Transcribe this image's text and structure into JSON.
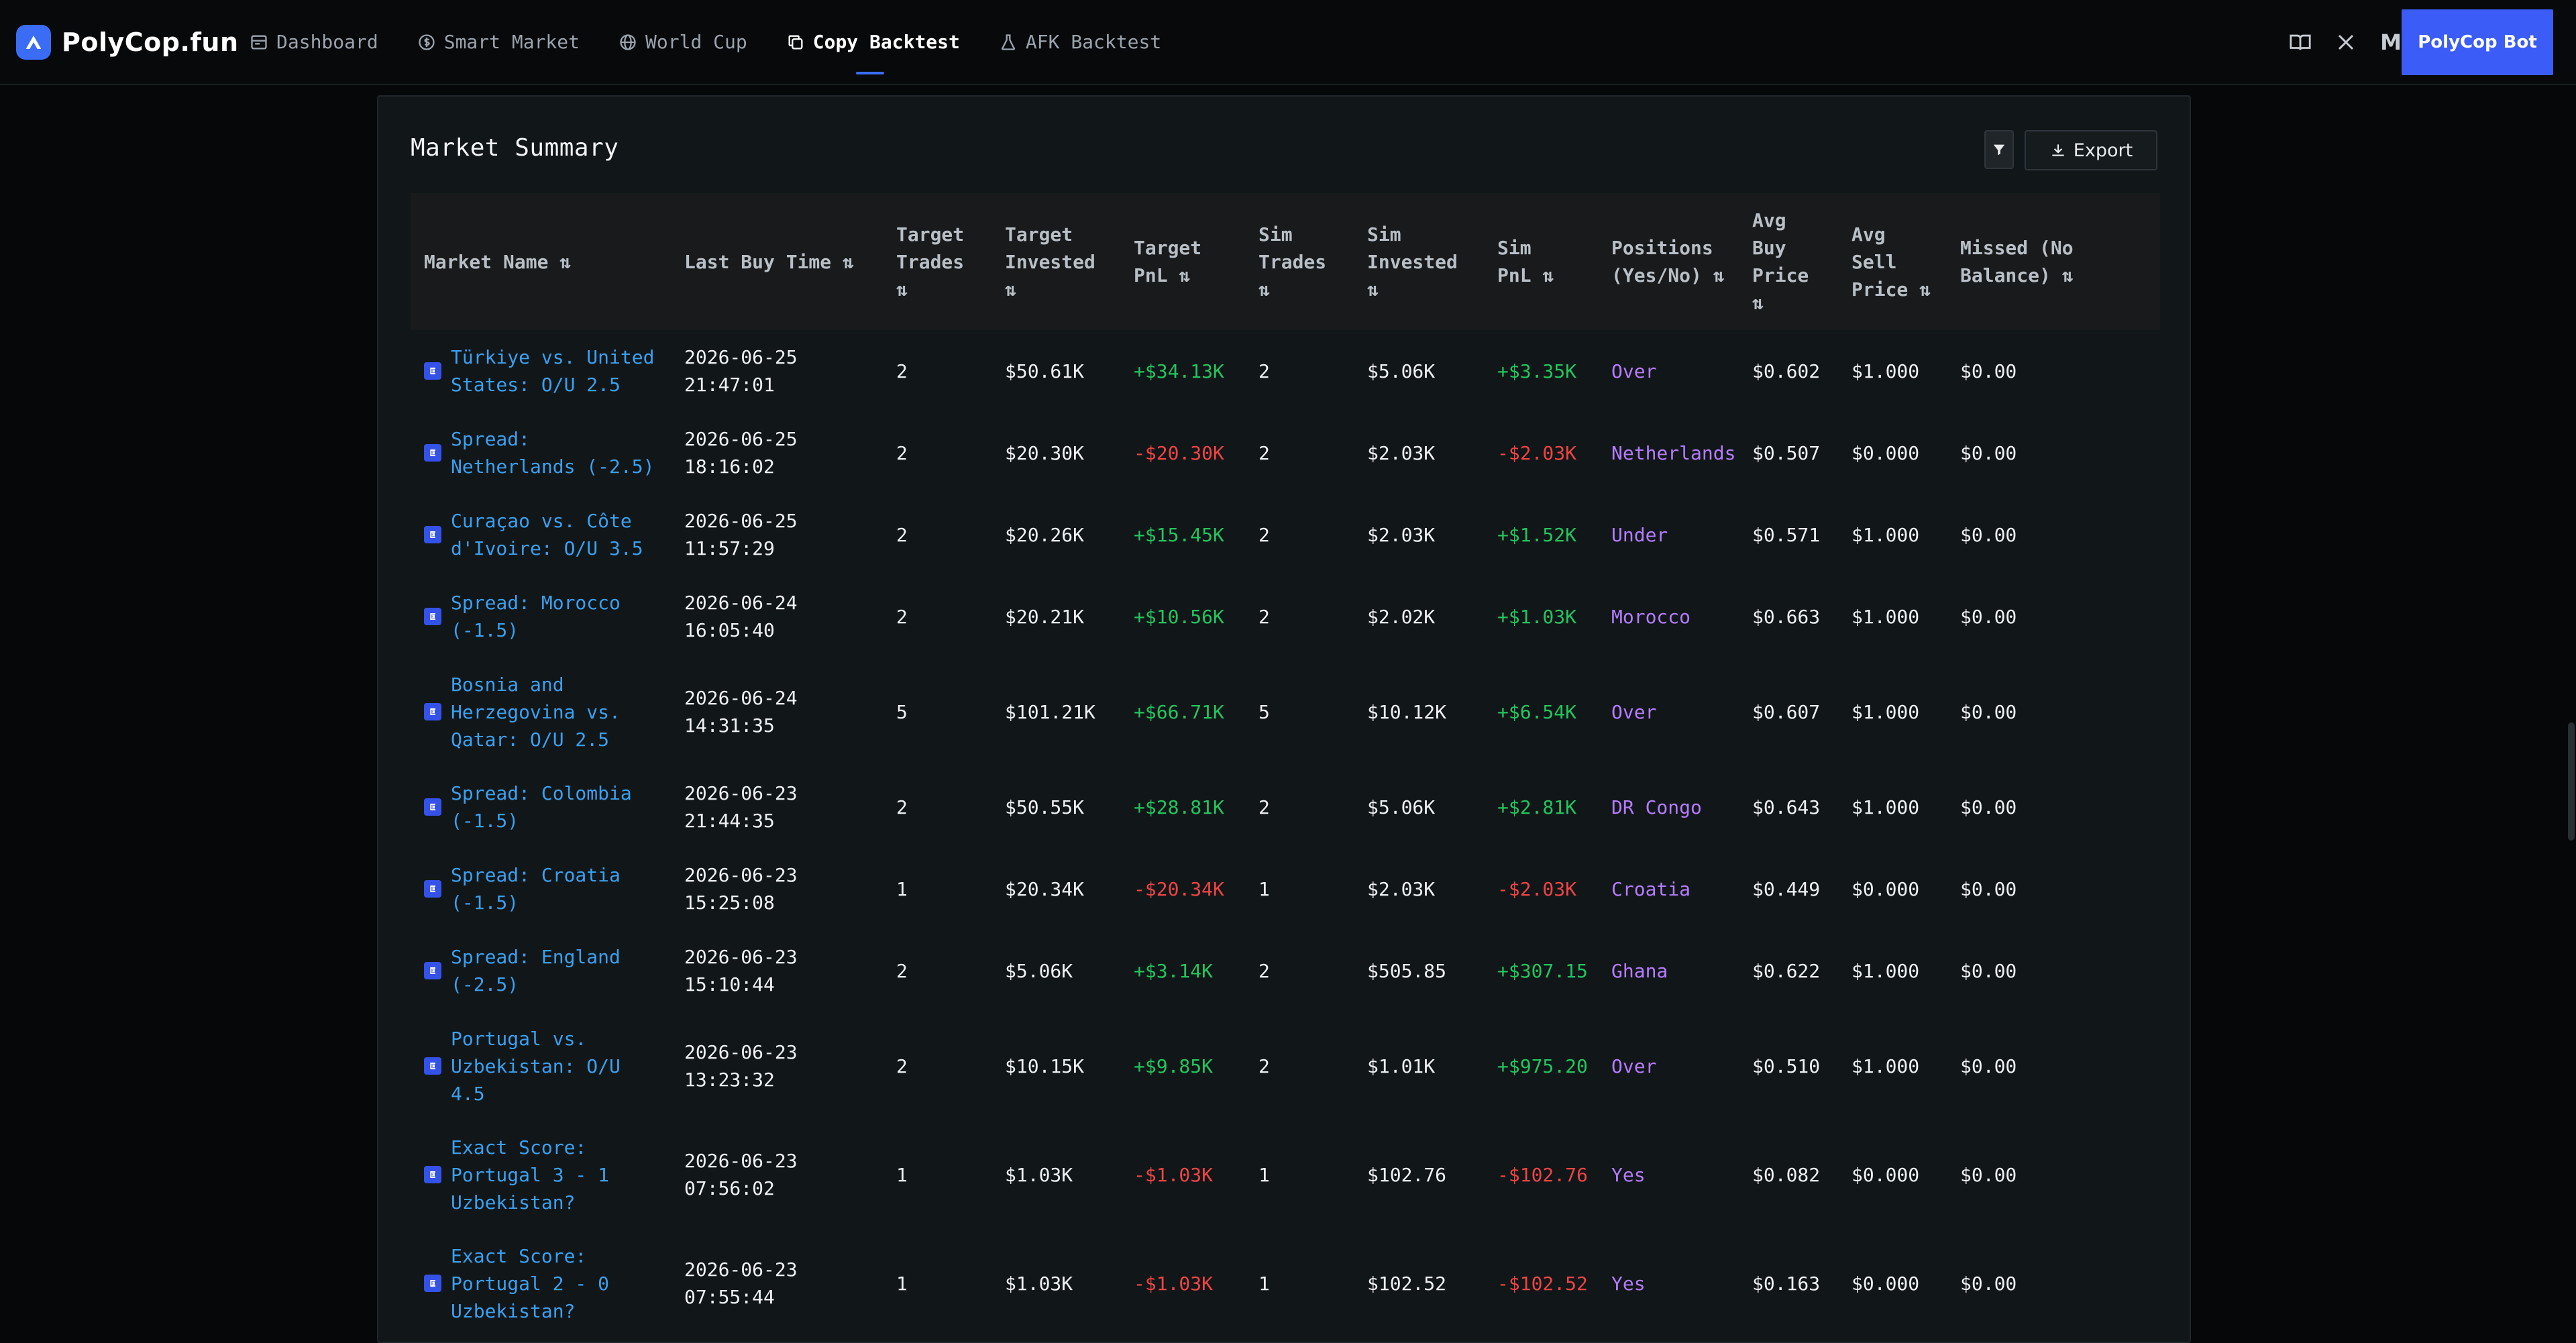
{
  "brand": {
    "name": "PolyCop.fun",
    "logo_icon": "polycop-logo-icon"
  },
  "nav": [
    {
      "label": "Dashboard",
      "icon": "dashboard-icon",
      "active": false
    },
    {
      "label": "Smart Market",
      "icon": "dollar-circle-icon",
      "active": false
    },
    {
      "label": "World Cup",
      "icon": "globe-icon",
      "active": false
    },
    {
      "label": "Copy Backtest",
      "icon": "copy-icon",
      "active": true
    },
    {
      "label": "AFK Backtest",
      "icon": "flask-icon",
      "active": false
    }
  ],
  "header_right": {
    "docs_icon": "book-icon",
    "x_icon": "x-icon",
    "medium_label": "M",
    "cta_label": "PolyCop Bot"
  },
  "panel": {
    "title": "Market Summary",
    "filter_icon": "filter-icon",
    "export_label": "Export"
  },
  "colors": {
    "accent": "#3b5cf6",
    "positive": "#22c55e",
    "negative": "#ef4444",
    "outcome": "#b57cff",
    "link": "#3aa0f0"
  },
  "table": {
    "columns": [
      "Market Name ⇅",
      "Last Buy Time ⇅",
      "Target Trades ⇅",
      "Target Invested ⇅",
      "Target PnL ⇅",
      "Sim Trades ⇅",
      "Sim Invested ⇅",
      "Sim PnL ⇅",
      "Positions (Yes/No) ⇅",
      "Avg Buy Price ⇅",
      "Avg Sell Price ⇅",
      "Missed (No Balance) ⇅"
    ],
    "rows": [
      {
        "market": "Türkiye vs. United States: O/U 2.5",
        "time": "2026-06-25 21:47:01",
        "target_trades": "2",
        "target_invested": "$50.61K",
        "target_pnl": "+$34.13K",
        "sim_trades": "2",
        "sim_invested": "$5.06K",
        "sim_pnl": "+$3.35K",
        "position": "Over",
        "avg_buy": "$0.602",
        "avg_sell": "$1.000",
        "missed": "$0.00"
      },
      {
        "market": "Spread: Netherlands (-2.5)",
        "time": "2026-06-25 18:16:02",
        "target_trades": "2",
        "target_invested": "$20.30K",
        "target_pnl": "-$20.30K",
        "sim_trades": "2",
        "sim_invested": "$2.03K",
        "sim_pnl": "-$2.03K",
        "position": "Netherlands",
        "avg_buy": "$0.507",
        "avg_sell": "$0.000",
        "missed": "$0.00"
      },
      {
        "market": "Curaçao vs. Côte d'Ivoire: O/U 3.5",
        "time": "2026-06-25 11:57:29",
        "target_trades": "2",
        "target_invested": "$20.26K",
        "target_pnl": "+$15.45K",
        "sim_trades": "2",
        "sim_invested": "$2.03K",
        "sim_pnl": "+$1.52K",
        "position": "Under",
        "avg_buy": "$0.571",
        "avg_sell": "$1.000",
        "missed": "$0.00"
      },
      {
        "market": "Spread: Morocco (-1.5)",
        "time": "2026-06-24 16:05:40",
        "target_trades": "2",
        "target_invested": "$20.21K",
        "target_pnl": "+$10.56K",
        "sim_trades": "2",
        "sim_invested": "$2.02K",
        "sim_pnl": "+$1.03K",
        "position": "Morocco",
        "avg_buy": "$0.663",
        "avg_sell": "$1.000",
        "missed": "$0.00"
      },
      {
        "market": "Bosnia and Herzegovina vs. Qatar: O/U 2.5",
        "time": "2026-06-24 14:31:35",
        "target_trades": "5",
        "target_invested": "$101.21K",
        "target_pnl": "+$66.71K",
        "sim_trades": "5",
        "sim_invested": "$10.12K",
        "sim_pnl": "+$6.54K",
        "position": "Over",
        "avg_buy": "$0.607",
        "avg_sell": "$1.000",
        "missed": "$0.00"
      },
      {
        "market": "Spread: Colombia (-1.5)",
        "time": "2026-06-23 21:44:35",
        "target_trades": "2",
        "target_invested": "$50.55K",
        "target_pnl": "+$28.81K",
        "sim_trades": "2",
        "sim_invested": "$5.06K",
        "sim_pnl": "+$2.81K",
        "position": "DR Congo",
        "avg_buy": "$0.643",
        "avg_sell": "$1.000",
        "missed": "$0.00"
      },
      {
        "market": "Spread: Croatia (-1.5)",
        "time": "2026-06-23 15:25:08",
        "target_trades": "1",
        "target_invested": "$20.34K",
        "target_pnl": "-$20.34K",
        "sim_trades": "1",
        "sim_invested": "$2.03K",
        "sim_pnl": "-$2.03K",
        "position": "Croatia",
        "avg_buy": "$0.449",
        "avg_sell": "$0.000",
        "missed": "$0.00"
      },
      {
        "market": "Spread: England (-2.5)",
        "time": "2026-06-23 15:10:44",
        "target_trades": "2",
        "target_invested": "$5.06K",
        "target_pnl": "+$3.14K",
        "sim_trades": "2",
        "sim_invested": "$505.85",
        "sim_pnl": "+$307.15",
        "position": "Ghana",
        "avg_buy": "$0.622",
        "avg_sell": "$1.000",
        "missed": "$0.00"
      },
      {
        "market": "Portugal vs. Uzbekistan: O/U 4.5",
        "time": "2026-06-23 13:23:32",
        "target_trades": "2",
        "target_invested": "$10.15K",
        "target_pnl": "+$9.85K",
        "sim_trades": "2",
        "sim_invested": "$1.01K",
        "sim_pnl": "+$975.20",
        "position": "Over",
        "avg_buy": "$0.510",
        "avg_sell": "$1.000",
        "missed": "$0.00"
      },
      {
        "market": "Exact Score: Portugal 3 - 1 Uzbekistan?",
        "time": "2026-06-23 07:56:02",
        "target_trades": "1",
        "target_invested": "$1.03K",
        "target_pnl": "-$1.03K",
        "sim_trades": "1",
        "sim_invested": "$102.76",
        "sim_pnl": "-$102.76",
        "position": "Yes",
        "avg_buy": "$0.082",
        "avg_sell": "$0.000",
        "missed": "$0.00"
      },
      {
        "market": "Exact Score: Portugal 2 - 0 Uzbekistan?",
        "time": "2026-06-23 07:55:44",
        "target_trades": "1",
        "target_invested": "$1.03K",
        "target_pnl": "-$1.03K",
        "sim_trades": "1",
        "sim_invested": "$102.52",
        "sim_pnl": "-$102.52",
        "position": "Yes",
        "avg_buy": "$0.163",
        "avg_sell": "$0.000",
        "missed": "$0.00"
      }
    ]
  }
}
